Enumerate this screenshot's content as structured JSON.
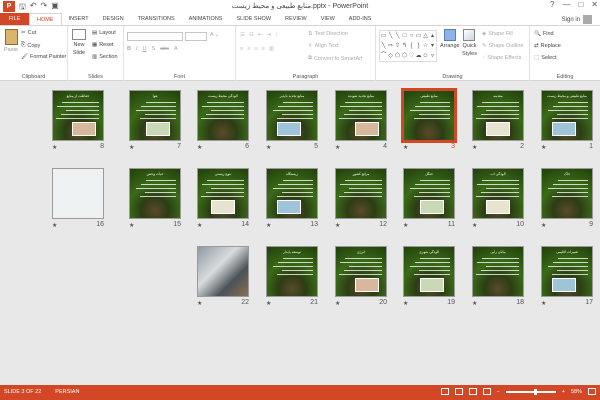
{
  "title_bar": {
    "app_icon_label": "P",
    "document_title": "منابع طبیعی و محیط زیست.pptx - PowerPoint",
    "qat_icons": [
      "save-icon",
      "undo-icon",
      "redo-icon",
      "start-from-beginning-icon"
    ],
    "window_controls": [
      "?",
      "—",
      "□",
      "✕"
    ]
  },
  "tabs": [
    "FILE",
    "HOME",
    "INSERT",
    "DESIGN",
    "TRANSITIONS",
    "ANIMATIONS",
    "SLIDE SHOW",
    "REVIEW",
    "VIEW",
    "ADD-INS"
  ],
  "active_tab": "HOME",
  "sign_in": "Sign in",
  "ribbon": {
    "clipboard": {
      "label": "Clipboard",
      "paste": "Paste",
      "cut": "Cut",
      "copy": "Copy",
      "format_painter": "Format Painter"
    },
    "slides": {
      "label": "Slides",
      "new_slide": "New",
      "new_slide_2": "Slide",
      "layout": "Layout",
      "reset": "Reset",
      "section": "Section"
    },
    "font": {
      "label": "Font"
    },
    "paragraph": {
      "label": "Paragraph",
      "text_direction": "Text Direction",
      "align_text": "Align Text",
      "convert_smartart": "Convert to SmartArt"
    },
    "drawing": {
      "label": "Drawing",
      "arrange": "Arrange",
      "quick_styles": "Quick",
      "quick_styles_2": "Styles",
      "shape_fill": "Shape Fill",
      "shape_outline": "Shape Outline",
      "shape_effects": "Shape Effects"
    },
    "editing": {
      "label": "Editing",
      "find": "Find",
      "replace": "Replace",
      "select": "Select"
    }
  },
  "slides": [
    {
      "n": "1",
      "title": "منابع طبیعی و محیط زیست",
      "kind": "green"
    },
    {
      "n": "2",
      "title": "مقدمه",
      "kind": "green"
    },
    {
      "n": "3",
      "title": "منابع طبیعی",
      "kind": "green",
      "selected": true
    },
    {
      "n": "4",
      "title": "منابع تجدید شونده",
      "kind": "green"
    },
    {
      "n": "5",
      "title": "منابع تجدید ناپذیر",
      "kind": "green"
    },
    {
      "n": "6",
      "title": "آلودگی محیط زیست",
      "kind": "green"
    },
    {
      "n": "7",
      "title": "هوا",
      "kind": "green"
    },
    {
      "n": "8",
      "title": "حفاظت از منابع",
      "kind": "green"
    },
    {
      "n": "9",
      "title": "خاک",
      "kind": "green"
    },
    {
      "n": "10",
      "title": "آلودگی آب",
      "kind": "green"
    },
    {
      "n": "11",
      "title": "جنگل",
      "kind": "green"
    },
    {
      "n": "12",
      "title": "مراتع کشور",
      "kind": "green"
    },
    {
      "n": "13",
      "title": "زیستگاه",
      "kind": "green"
    },
    {
      "n": "14",
      "title": "تنوع زیستی",
      "kind": "green"
    },
    {
      "n": "15",
      "title": "حیات وحش",
      "kind": "green"
    },
    {
      "n": "16",
      "title": "",
      "kind": "light"
    },
    {
      "n": "17",
      "title": "تغییرات اقلیمی",
      "kind": "green"
    },
    {
      "n": "18",
      "title": "بیابان زایی",
      "kind": "green"
    },
    {
      "n": "19",
      "title": "آلودگی شهری",
      "kind": "green"
    },
    {
      "n": "20",
      "title": "انرژی",
      "kind": "green"
    },
    {
      "n": "21",
      "title": "توسعه پایدار",
      "kind": "green"
    },
    {
      "n": "22",
      "title": "",
      "kind": "photo"
    }
  ],
  "status_bar": {
    "slide_of": "SLIDE 3 OF 22",
    "language": "PERSIAN",
    "zoom": "58%"
  }
}
